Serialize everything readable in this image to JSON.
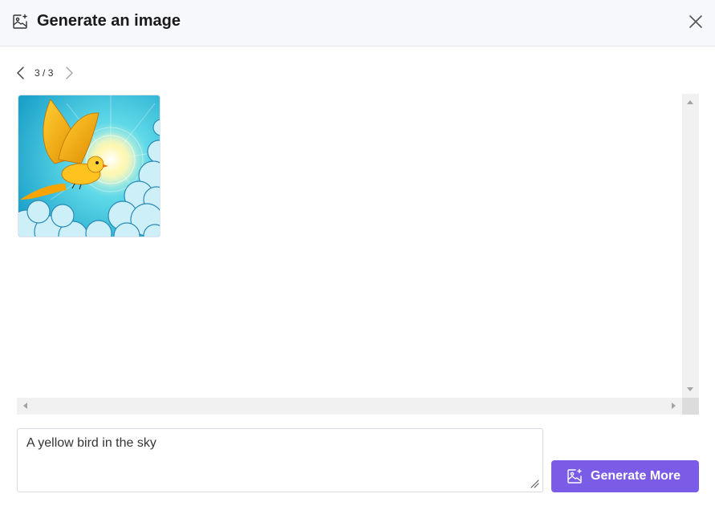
{
  "dialog": {
    "title": "Generate an image",
    "icons": {
      "title": "image-sparkle-icon",
      "close": "close-icon"
    }
  },
  "pager": {
    "current": "3",
    "separator": " / ",
    "total": "3",
    "icons": {
      "prev": "chevron-left-icon",
      "next": "chevron-right-icon"
    }
  },
  "gallery": {
    "images": [
      {
        "alt": "yellow bird flying in the sky",
        "icon": "generated-image"
      }
    ]
  },
  "prompt": {
    "value": "A yellow bird in the sky"
  },
  "generate_button": {
    "label": "Generate More",
    "icon": "image-sparkle-icon"
  },
  "colors": {
    "accent": "#7b5ce6",
    "header_bg": "#f7f8fc",
    "scrollbar_bg": "#f1f1f1"
  }
}
